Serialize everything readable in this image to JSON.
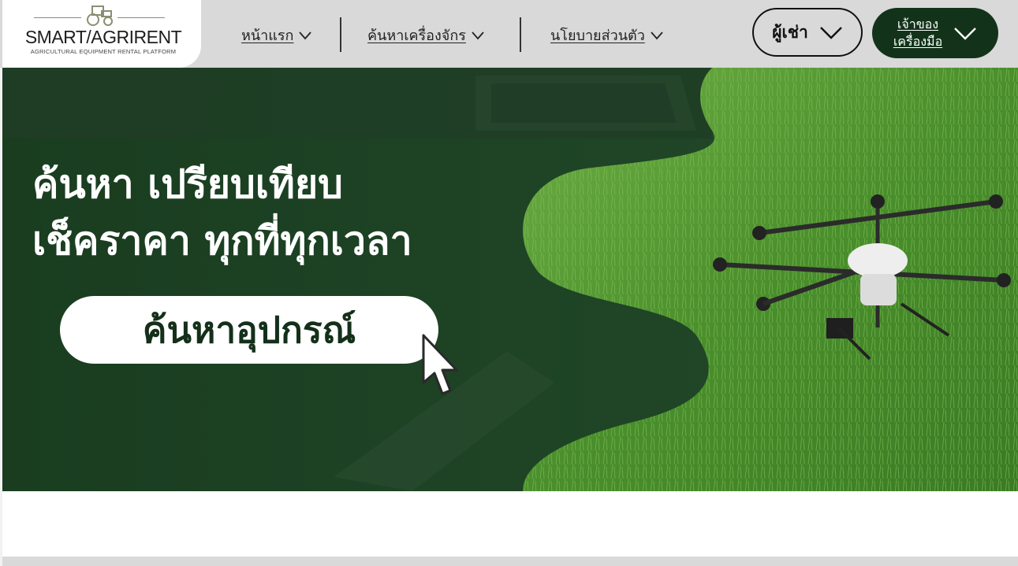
{
  "logo": {
    "title": "SMART/AGRIRENT",
    "subtitle": "AGRICULTURAL EQUIPMENT RENTAL PLATFORM",
    "icon": "tractor-icon"
  },
  "nav": {
    "items": [
      {
        "label": "หน้าแรก",
        "icon": "chevron-down-icon"
      },
      {
        "label": "ค้นหาเครื่องจักร",
        "icon": "chevron-down-icon"
      },
      {
        "label": "นโยบายส่วนตัว",
        "icon": "chevron-down-icon"
      }
    ]
  },
  "header_buttons": {
    "renter_label": "ผู้เช่า",
    "owner_line1": "เจ้าของ",
    "owner_line2": "เครื่องมือ"
  },
  "hero": {
    "headline_line1": "ค้นหา เปรียบเทียบ",
    "headline_line2": "เช็คราคา ทุกที่ทุกเวลา",
    "search_button": "ค้นหาอุปกรณ์"
  },
  "colors": {
    "brand_dark_green": "#12331a",
    "header_gray": "#d9d9d9",
    "grass_green": "#4f8f2f"
  }
}
